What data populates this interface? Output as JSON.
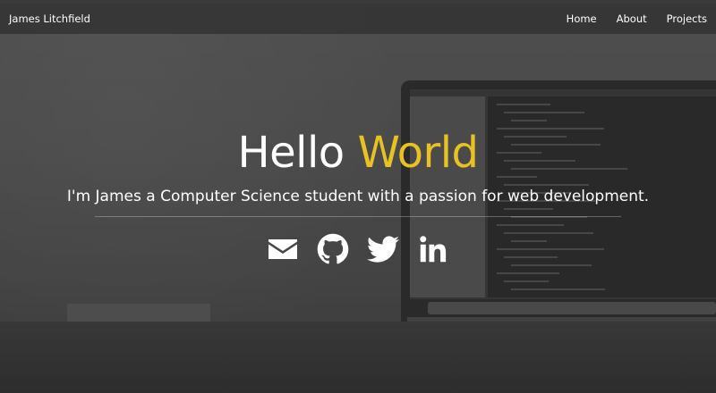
{
  "navbar": {
    "brand": "James Litchfield",
    "links": [
      {
        "label": "Home"
      },
      {
        "label": "About"
      },
      {
        "label": "Projects"
      }
    ]
  },
  "hero": {
    "title_part1": "Hello",
    "title_part2": "World",
    "accent_color": "#e8c123",
    "tagline": "I'm James a Computer Science student with a passion for web development."
  },
  "social_icons": [
    "envelope-icon",
    "github-icon",
    "twitter-icon",
    "linkedin-icon"
  ]
}
